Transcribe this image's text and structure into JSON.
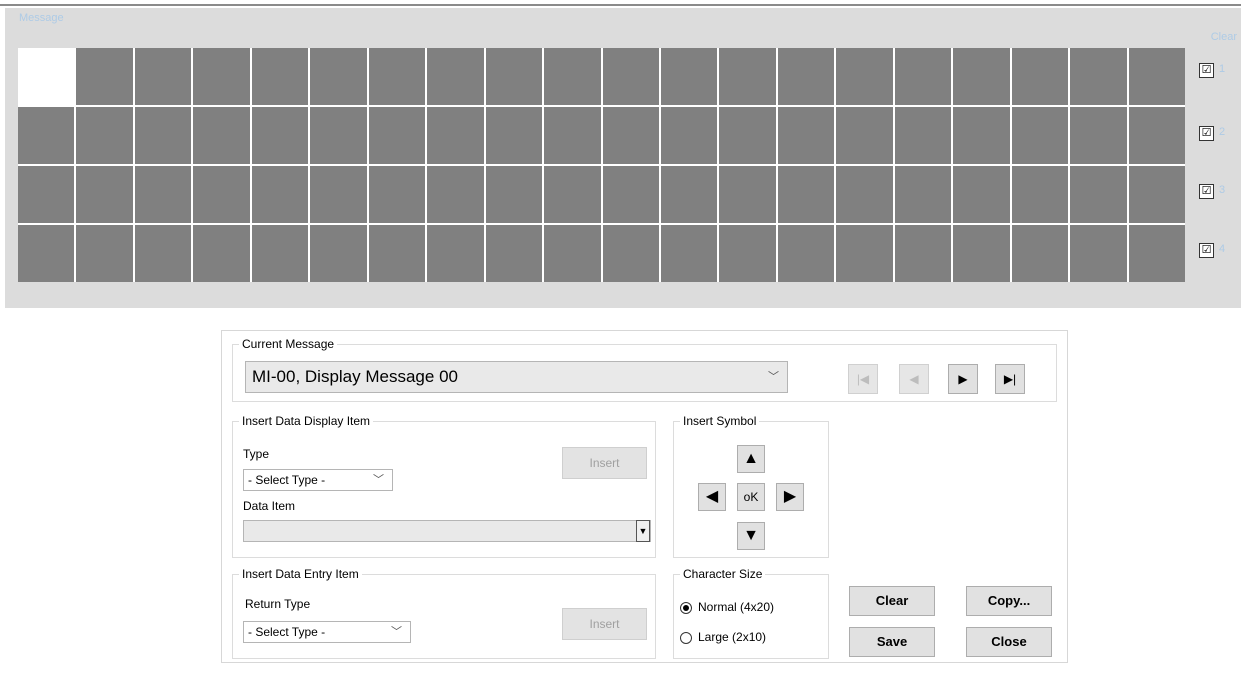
{
  "message_panel": {
    "title": "Message",
    "clear_header": "Clear",
    "rows": [
      {
        "label": "1",
        "checked": true
      },
      {
        "label": "2",
        "checked": true
      },
      {
        "label": "3",
        "checked": true
      },
      {
        "label": "4",
        "checked": true
      }
    ],
    "grid": {
      "rows": 4,
      "cols": 20,
      "active_cell": [
        0,
        0
      ]
    },
    "check_mark": "☑"
  },
  "current_message": {
    "legend": "Current Message",
    "selected": "MI-00,  Display Message 00",
    "nav": {
      "first": "|◀",
      "prev": "◀",
      "next": "▶",
      "last": "▶|"
    }
  },
  "insert_display": {
    "legend": "Insert Data Display Item",
    "type_label": "Type",
    "type_value": "- Select Type -",
    "data_item_label": "Data Item",
    "data_item_value": "",
    "insert_label": "Insert"
  },
  "insert_symbol": {
    "legend": "Insert Symbol",
    "up": "▲",
    "left": "◀",
    "ok": "oK",
    "right": "▶",
    "down": "▼"
  },
  "insert_entry": {
    "legend": "Insert Data Entry Item",
    "return_type_label": "Return Type",
    "return_type_value": "- Select Type -",
    "insert_label": "Insert"
  },
  "character_size": {
    "legend": "Character Size",
    "normal_label": "Normal (4x20)",
    "large_label": "Large (2x10)",
    "selected": "normal"
  },
  "actions": {
    "clear": "Clear",
    "copy": "Copy...",
    "save": "Save",
    "close": "Close"
  }
}
